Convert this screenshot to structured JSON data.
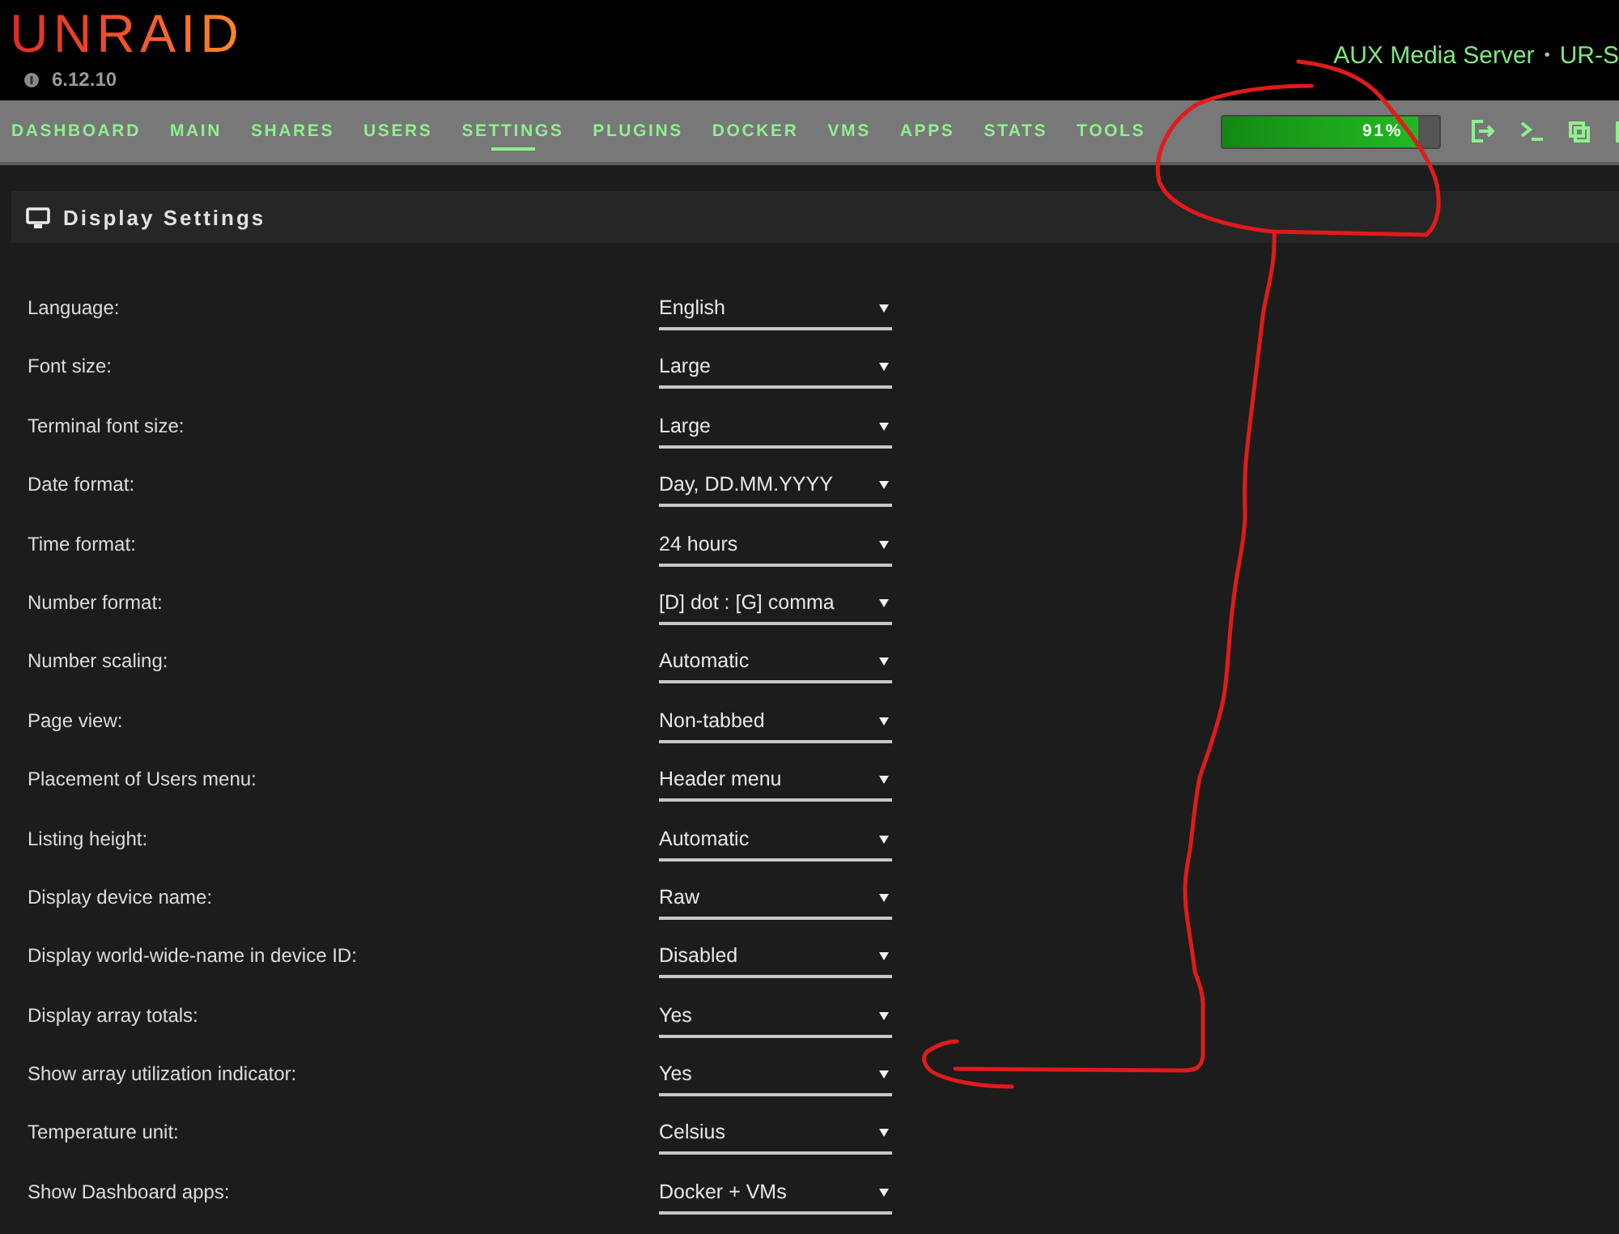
{
  "header": {
    "logo": "UNRAID",
    "version": "6.12.10",
    "server_name": "AUX Media Server",
    "separator": "•",
    "server_description": "UR-S"
  },
  "nav": {
    "tabs": [
      {
        "label": "DASHBOARD",
        "selected": false
      },
      {
        "label": "MAIN",
        "selected": false
      },
      {
        "label": "SHARES",
        "selected": false
      },
      {
        "label": "USERS",
        "selected": false
      },
      {
        "label": "SETTINGS",
        "selected": true
      },
      {
        "label": "PLUGINS",
        "selected": false
      },
      {
        "label": "DOCKER",
        "selected": false
      },
      {
        "label": "VMS",
        "selected": false
      },
      {
        "label": "APPS",
        "selected": false
      },
      {
        "label": "STATS",
        "selected": false
      },
      {
        "label": "TOOLS",
        "selected": false
      }
    ],
    "utilization": {
      "level": 0.91,
      "reading": "91%"
    }
  },
  "section": {
    "title": "Display Settings"
  },
  "settings": [
    {
      "label": "Language:",
      "value": "English"
    },
    {
      "label": "Font size:",
      "value": "Large"
    },
    {
      "label": "Terminal font size:",
      "value": "Large"
    },
    {
      "label": "Date format:",
      "value": "Day, DD.MM.YYYY"
    },
    {
      "label": "Time format:",
      "value": "24 hours"
    },
    {
      "label": "Number format:",
      "value": "[D] dot : [G] comma"
    },
    {
      "label": "Number scaling:",
      "value": "Automatic"
    },
    {
      "label": "Page view:",
      "value": "Non-tabbed"
    },
    {
      "label": "Placement of Users menu:",
      "value": "Header menu"
    },
    {
      "label": "Listing height:",
      "value": "Automatic"
    },
    {
      "label": "Display device name:",
      "value": "Raw"
    },
    {
      "label": "Display world-wide-name in device ID:",
      "value": "Disabled"
    },
    {
      "label": "Display array totals:",
      "value": "Yes"
    },
    {
      "label": "Show array utilization indicator:",
      "value": "Yes"
    },
    {
      "label": "Temperature unit:",
      "value": "Celsius"
    },
    {
      "label": "Show Dashboard apps:",
      "value": "Docker + VMs"
    }
  ]
}
